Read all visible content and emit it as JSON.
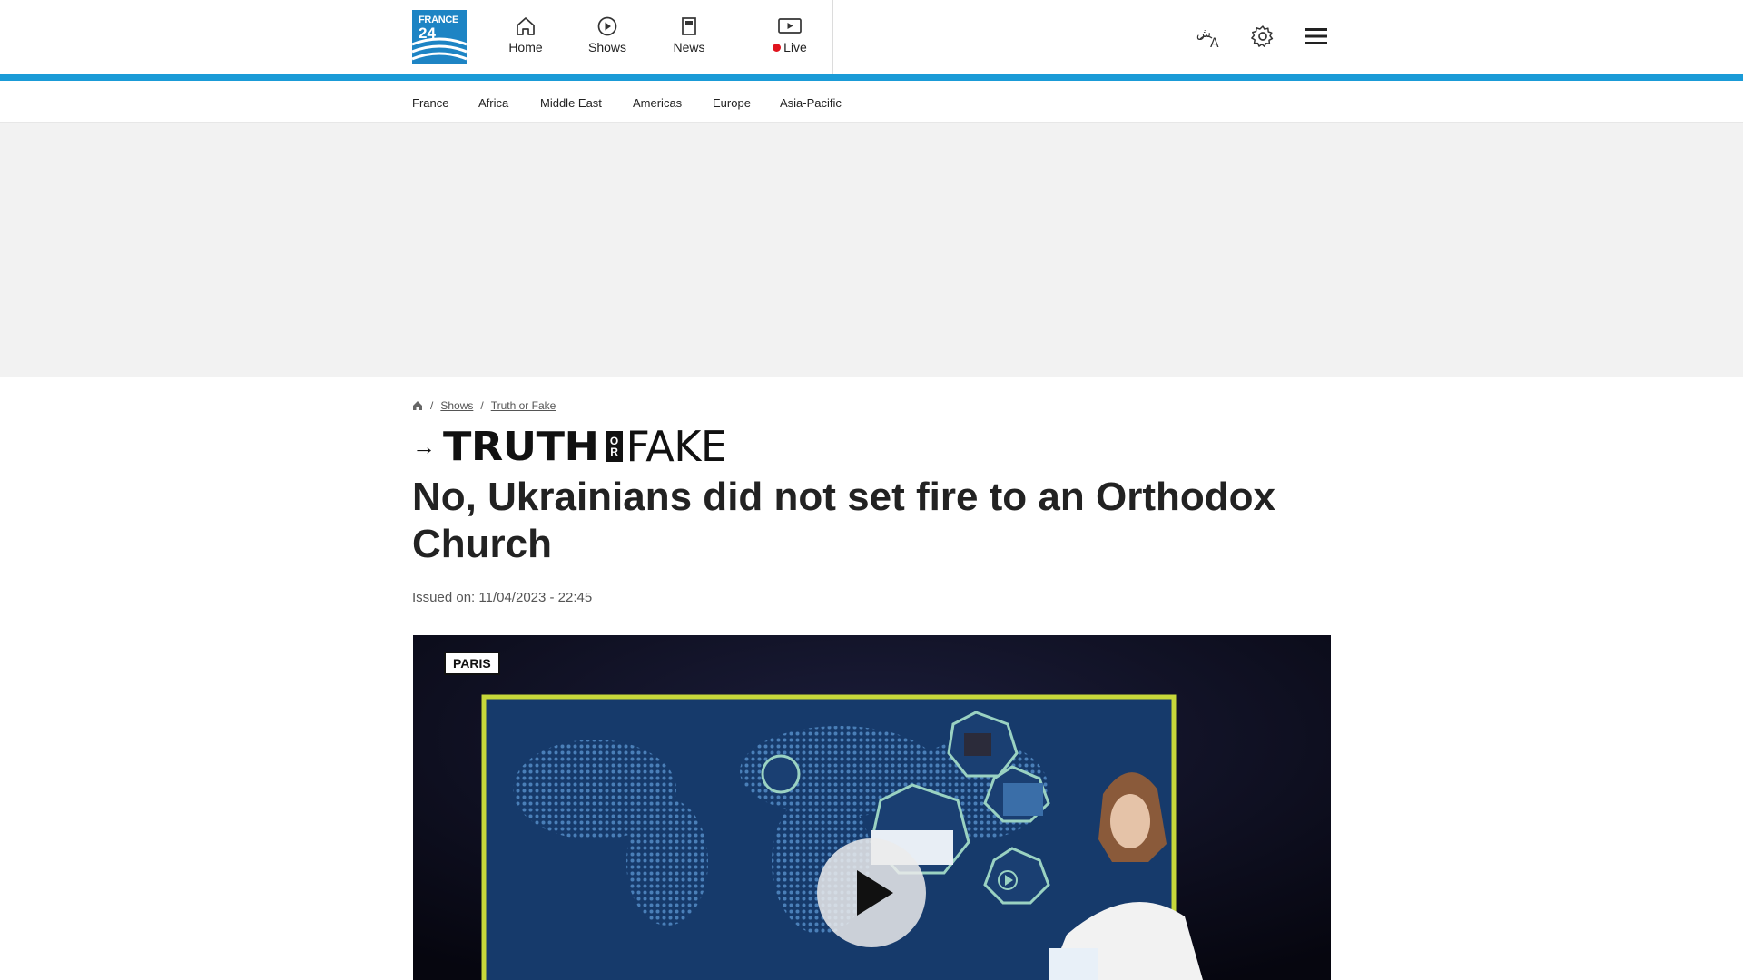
{
  "brand": {
    "logo_line1": "FRANCE",
    "logo_line2": "24"
  },
  "nav": {
    "home_label": "Home",
    "shows_label": "Shows",
    "news_label": "News",
    "live_label": "Live"
  },
  "tools": {
    "language_icon": "language-icon",
    "settings_icon": "gear-icon",
    "menu_icon": "hamburger-menu-icon"
  },
  "subnav": {
    "items": [
      "France",
      "Africa",
      "Middle East",
      "Americas",
      "Europe",
      "Asia-Pacific"
    ]
  },
  "breadcrumb": {
    "shows": "Shows",
    "truth_or_fake": "Truth or Fake"
  },
  "show": {
    "arrow": "→",
    "truth": "TRUTH",
    "or_top": "O",
    "or_bottom": "R",
    "fake": "FAKE"
  },
  "article": {
    "headline": "No, Ukrainians did not set fire to an Orthodox Church",
    "issued": "Issued on: 11/04/2023 - 22:45"
  },
  "video": {
    "location_tag": "PARIS"
  },
  "colors": {
    "accent": "#1a9bd7",
    "logo_bg": "#1d84c4",
    "live_dot": "#e0141e"
  }
}
